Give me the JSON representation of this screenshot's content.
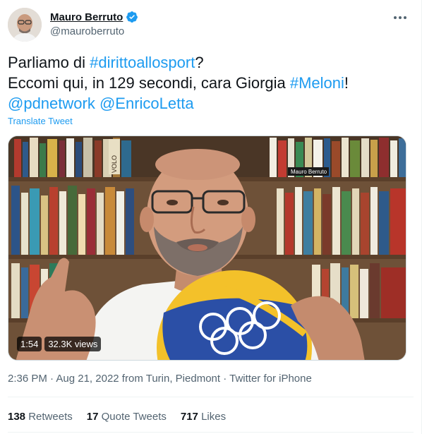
{
  "author": {
    "name": "Mauro Berruto",
    "handle": "@mauroberruto",
    "verified": true
  },
  "tweet": {
    "line1": {
      "pre": "Parliamo di ",
      "hashtag": "#dirittoallosport",
      "post": "?"
    },
    "line2": {
      "pre": "Eccomi qui, in 129 secondi, cara Giorgia ",
      "hashtag": "#Meloni",
      "post": "!"
    },
    "line3": {
      "mention1": "@pdnetwork",
      "sep": " ",
      "mention2": "@EnricoLetta"
    },
    "translate_label": "Translate Tweet"
  },
  "media": {
    "duration": "1:54",
    "views": "32.3K views",
    "book_label_1": "Mauro Berruto",
    "book_label_2": "VOLO"
  },
  "meta": {
    "time": "2:36 PM",
    "sep1": " · ",
    "date": "Aug 21, 2022",
    "location_prefix": " from ",
    "location": "Turin, Piedmont",
    "sep2": " · ",
    "source": "Twitter for iPhone"
  },
  "stats": {
    "retweets_count": "138",
    "retweets_label": "Retweets",
    "quote_count": "17",
    "quote_label": "Quote Tweets",
    "likes_count": "717",
    "likes_label": "Likes"
  },
  "colors": {
    "accent": "#1d9bf0",
    "text": "#0f1419",
    "secondary": "#536471"
  },
  "icons": {
    "verified": "verified-badge-icon",
    "more": "more-options-icon"
  }
}
